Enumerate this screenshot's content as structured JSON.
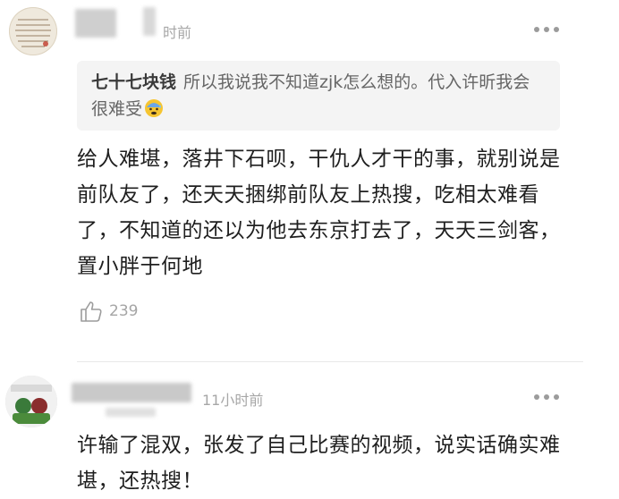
{
  "comments": [
    {
      "author": "",
      "time_suffix": "时前",
      "quote": {
        "author": "七十七块钱",
        "text": "所以我说我不知道zjk怎么想的。代入许昕我会很难受"
      },
      "text": "给人难堪，落井下石呗，干仇人才干的事，就别说是前队友了，还天天捆绑前队友上热搜，吃相太难看了，不知道的还以为他去东京打去了，天天三剑客，置小胖于何地",
      "likes": "239"
    },
    {
      "author": "",
      "time": "11小时前",
      "text": "许输了混双，张发了自己比赛的视频，说实话确实难堪，还热搜！"
    }
  ],
  "icons": {
    "more": "more-dots-icon",
    "like": "thumbs-up-icon",
    "quote_emoji": "anxious-sweat-face-emoji"
  }
}
